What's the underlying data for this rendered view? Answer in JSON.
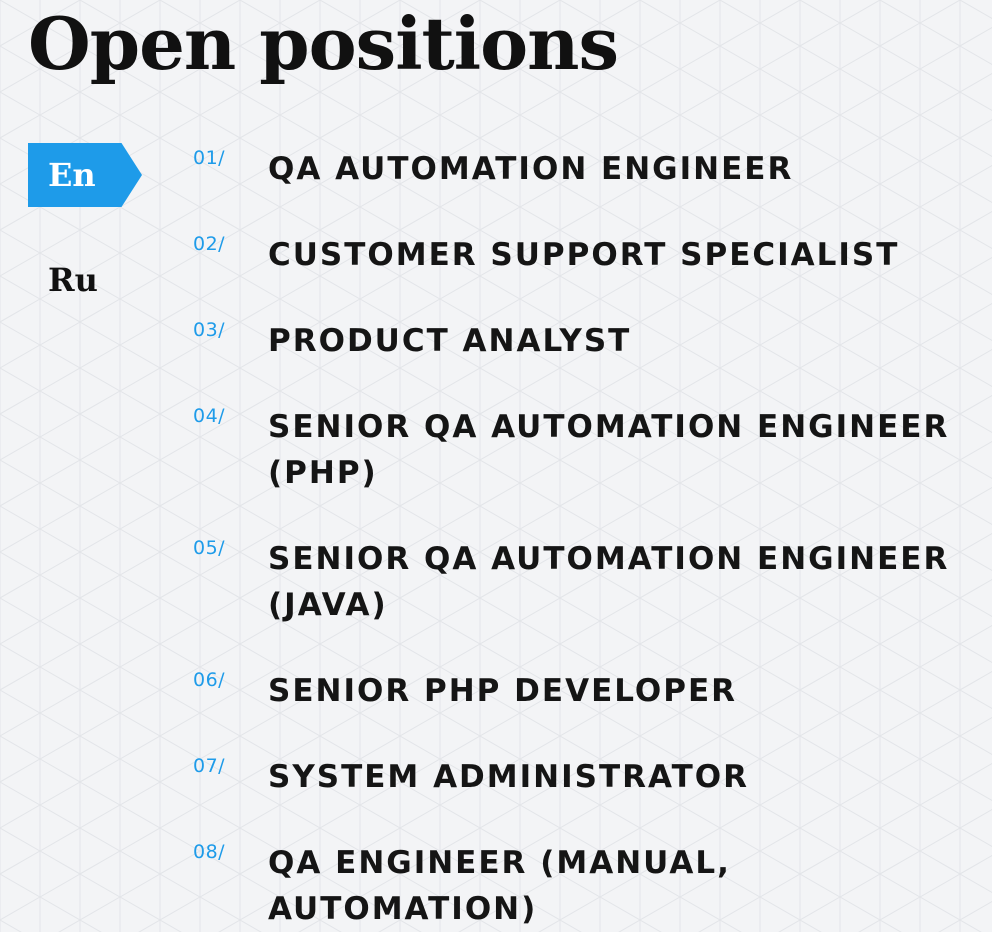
{
  "page": {
    "title": "Open positions"
  },
  "colors": {
    "accent": "#1e9be9",
    "text": "#151515",
    "background": "#f3f4f6"
  },
  "language_switch": {
    "items": [
      {
        "label": "En",
        "active": true
      },
      {
        "label": "Ru",
        "active": false
      }
    ]
  },
  "positions": [
    {
      "number": "01/",
      "title": "QA AUTOMATION ENGINEER"
    },
    {
      "number": "02/",
      "title": "CUSTOMER SUPPORT SPECIALIST"
    },
    {
      "number": "03/",
      "title": "PRODUCT ANALYST"
    },
    {
      "number": "04/",
      "title": "SENIOR QA AUTOMATION ENGINEER\n(PHP)"
    },
    {
      "number": "05/",
      "title": "SENIOR QA AUTOMATION ENGINEER\n(JAVA)"
    },
    {
      "number": "06/",
      "title": "SENIOR PHP DEVELOPER"
    },
    {
      "number": "07/",
      "title": "SYSTEM ADMINISTRATOR"
    },
    {
      "number": "08/",
      "title": "QA ENGINEER (MANUAL,\nAUTOMATION)"
    }
  ]
}
